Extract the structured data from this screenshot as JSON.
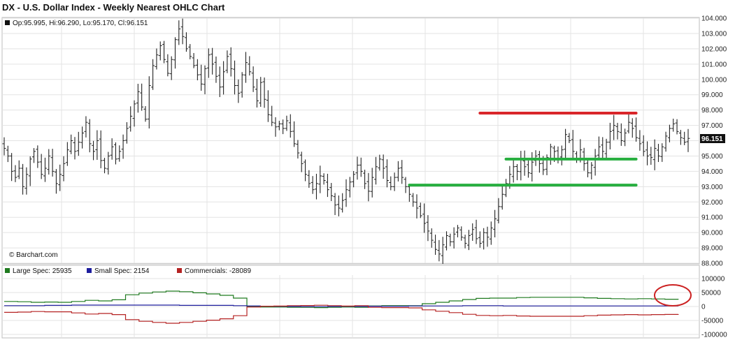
{
  "title": "DX - U.S. Dollar Index - Weekly Nearest OHLC Chart",
  "ohlc_label": "Op:95.995, Hi:96.290, Lo:95.170, Cl:96.151",
  "watermark": "© Barchart.com",
  "last_price_tag": "96.151",
  "colors": {
    "bars": "#222222",
    "grid": "#e3e3e3",
    "red_line": "#d9262a",
    "green_line": "#27ae3f",
    "large_spec": "#1f7a1f",
    "small_spec": "#1d1d9e",
    "commercials": "#b52222",
    "circle": "#cc2222"
  },
  "chart_data": [
    {
      "type": "ohlc",
      "title": "DX - U.S. Dollar Index - Weekly Nearest OHLC Chart",
      "ylim": [
        88,
        104
      ],
      "ytick_labels": [
        "104.000",
        "103.000",
        "102.000",
        "101.000",
        "100.000",
        "99.000",
        "98.000",
        "97.000",
        "96.000",
        "95.000",
        "94.000",
        "93.000",
        "92.000",
        "91.000",
        "90.000",
        "89.000",
        "88.000"
      ],
      "close_path": [
        95.5,
        95.0,
        94.0,
        93.6,
        94.2,
        93.0,
        93.8,
        94.8,
        95.3,
        94.6,
        93.8,
        94.2,
        95.0,
        94.0,
        93.2,
        93.8,
        94.5,
        95.4,
        96.0,
        95.3,
        95.9,
        96.5,
        97.2,
        95.8,
        95.3,
        96.0,
        94.7,
        94.2,
        95.0,
        95.6,
        94.8,
        95.3,
        96.0,
        96.8,
        97.6,
        98.4,
        99.2,
        98.2,
        97.4,
        99.6,
        100.9,
        101.6,
        102.2,
        101.3,
        100.4,
        101.3,
        102.6,
        103.3,
        102.8,
        102.0,
        101.5,
        100.9,
        100.3,
        99.7,
        100.7,
        101.6,
        101.0,
        100.2,
        99.5,
        100.5,
        101.5,
        100.7,
        99.6,
        99.1,
        100.3,
        101.1,
        100.5,
        99.5,
        98.6,
        99.8,
        98.7,
        97.7,
        97.2,
        96.9,
        97.1,
        96.8,
        97.3,
        96.6,
        95.8,
        95.2,
        94.5,
        93.8,
        93.2,
        92.8,
        93.2,
        93.7,
        93.4,
        92.8,
        92.4,
        91.8,
        91.6,
        92.1,
        92.8,
        93.3,
        93.8,
        94.4,
        94.0,
        93.2,
        92.7,
        93.6,
        94.3,
        94.8,
        94.2,
        93.4,
        93.0,
        93.6,
        94.2,
        93.6,
        93.0,
        92.5,
        92.0,
        91.6,
        91.1,
        90.6,
        90.1,
        89.5,
        88.9,
        88.6,
        89.2,
        89.8,
        89.4,
        89.9,
        90.3,
        89.7,
        89.3,
        89.8,
        90.2,
        89.6,
        89.3,
        90.0,
        89.7,
        90.3,
        90.9,
        91.7,
        92.5,
        93.2,
        93.8,
        94.3,
        94.0,
        94.8,
        94.3,
        93.9,
        94.6,
        95.0,
        94.5,
        94.1,
        94.9,
        95.6,
        95.3,
        94.8,
        95.4,
        96.4,
        96.0,
        95.3,
        94.8,
        95.4,
        94.5,
        93.9,
        94.4,
        95.0,
        95.6,
        95.3,
        95.9,
        96.6,
        97.0,
        96.6,
        96.0,
        96.5,
        97.2,
        96.8,
        96.2,
        95.8,
        95.3,
        95.0,
        94.9,
        95.5,
        95.0,
        95.6,
        96.3,
        96.8,
        97.1,
        96.6,
        96.2,
        95.9,
        96.15
      ],
      "annotations": [
        {
          "type": "hline",
          "color": "red",
          "y": 97.8,
          "x_from_bar": 128,
          "x_to_bar": 170
        },
        {
          "type": "hline",
          "color": "green",
          "y": 94.8,
          "x_from_bar": 135,
          "x_to_bar": 170
        },
        {
          "type": "hline",
          "color": "green",
          "y": 93.1,
          "x_from_bar": 109,
          "x_to_bar": 170
        }
      ],
      "last_close": 96.151
    },
    {
      "type": "line",
      "title": "COT positions",
      "ylim": [
        -100000,
        100000
      ],
      "ytick_labels": [
        "100000",
        "50000",
        "0",
        "-50000",
        "-100000"
      ],
      "series": [
        {
          "name": "Large Spec",
          "label": "Large Spec: 25935",
          "color_key": "large_spec",
          "last": 25935,
          "values": [
            18000,
            17000,
            15000,
            16000,
            15000,
            18000,
            22000,
            20000,
            24000,
            42000,
            48000,
            52000,
            55000,
            53000,
            49000,
            45000,
            40000,
            30000,
            0,
            -2000,
            -2000,
            -3000,
            -3000,
            -4000,
            -3000,
            -2000,
            -3000,
            2000,
            3000,
            3000,
            3000,
            10000,
            15000,
            20000,
            25000,
            29000,
            30000,
            30000,
            32000,
            33000,
            33000,
            33000,
            33000,
            31000,
            29000,
            28000,
            27000,
            28000,
            27000,
            26000,
            25935
          ]
        },
        {
          "name": "Small Spec",
          "label": "Small Spec: 2154",
          "color_key": "small_spec",
          "last": 2154,
          "values": [
            3000,
            3000,
            3000,
            4000,
            4000,
            5000,
            5000,
            5000,
            5000,
            5000,
            5000,
            5000,
            5000,
            4000,
            4000,
            4000,
            4000,
            3000,
            2000,
            1000,
            500,
            0,
            -500,
            -500,
            0,
            500,
            0,
            1000,
            1000,
            1000,
            2000,
            2000,
            2000,
            2000,
            3000,
            3000,
            3000,
            2000,
            2000,
            2000,
            2000,
            2000,
            2000,
            2000,
            2000,
            2000,
            2000,
            2000,
            2000,
            2154,
            2154
          ]
        },
        {
          "name": "Commercials",
          "label": "Commercials: -28089",
          "color_key": "commercials",
          "last": -28089,
          "values": [
            -21000,
            -20000,
            -18000,
            -19000,
            -19000,
            -23000,
            -27000,
            -25000,
            -29000,
            -47000,
            -53000,
            -57000,
            -60000,
            -57000,
            -53000,
            -49000,
            -44000,
            -33000,
            -2000,
            1000,
            1500,
            3000,
            3500,
            4500,
            3000,
            1500,
            3000,
            -3000,
            -4000,
            -4000,
            -5000,
            -12000,
            -17000,
            -22000,
            -28000,
            -32000,
            -33000,
            -32000,
            -34000,
            -35000,
            -35000,
            -35000,
            -35000,
            -33000,
            -31000,
            -30000,
            -29000,
            -30000,
            -29000,
            -28500,
            -28089
          ]
        }
      ]
    }
  ]
}
